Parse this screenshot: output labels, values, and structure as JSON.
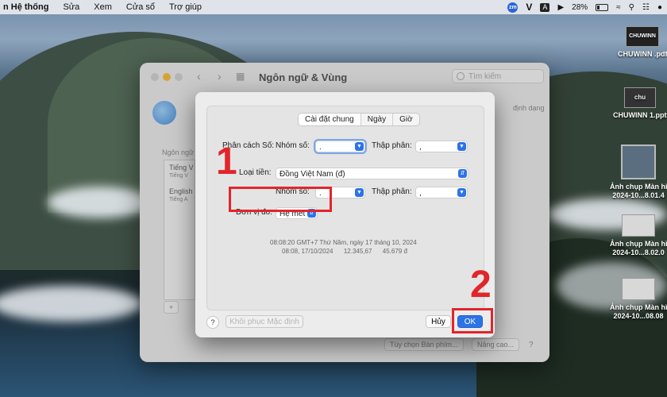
{
  "menubar": {
    "items": [
      "n Hệ thống",
      "Sửa",
      "Xem",
      "Cửa sổ",
      "Trợ giúp"
    ],
    "zoom_icon_label": "zm",
    "input_label": "A",
    "battery_percent": "28%"
  },
  "desktop_files": [
    {
      "name": "CHUWINN .pdf",
      "thumb_text": "CHUWINN"
    },
    {
      "name": "CHUWINN 1.pptx",
      "thumb_text": "chu"
    },
    {
      "name_line1": "Ảnh chụp Màn hì",
      "name_line2": "2024-10...8.01.4"
    },
    {
      "name_line1": "Ảnh chụp Màn hì",
      "name_line2": "2024-10...8.02.0"
    },
    {
      "name_line1": "Ảnh chụp Màn hì",
      "name_line2": "2024-10...08.08"
    }
  ],
  "settings_window": {
    "title": "Ngôn ngữ & Vùng",
    "search_placeholder": "Tìm kiếm",
    "lang_list_label": "Ngôn ngữ",
    "lang_item1": "Tiếng V",
    "lang_item1_sub": "Tiếng V",
    "lang_item2": "English",
    "lang_item2_sub": "Tiếng A",
    "side_text": "định dạng",
    "keyboard_button": "Tùy chọn Bàn phím...",
    "advanced_button": "Nâng cao...",
    "help": "?",
    "add": "+"
  },
  "dialog": {
    "tabs": [
      "Cài đặt chung",
      "Ngày",
      "Giờ"
    ],
    "number_separators_label": "Phân cách Số:",
    "grouping_label": "Nhóm số:",
    "grouping_value": ".",
    "decimal_label": "Thập phân:",
    "decimal_value": ",",
    "currency_label": "Loại tiền:",
    "currency_value": "Đồng Việt Nam (đ)",
    "currency_grouping_label": "Nhóm số:",
    "currency_grouping_value": ".",
    "currency_decimal_label": "Thập phân:",
    "currency_decimal_value": ",",
    "measurement_label": "Đơn vị đo:",
    "measurement_value": "Hệ mét",
    "preview_line1": "08:08:20 GMT+7 Thứ Năm, ngày 17 tháng 10, 2024",
    "preview_line2": "08:08, 17/10/2024      12.345,67      45.679 đ",
    "help": "?",
    "restore_defaults": "Khôi phục Mặc định",
    "cancel": "Hủy",
    "ok": "OK"
  },
  "annotations": {
    "step1": "1",
    "step2": "2",
    "color": "#e2252b"
  }
}
